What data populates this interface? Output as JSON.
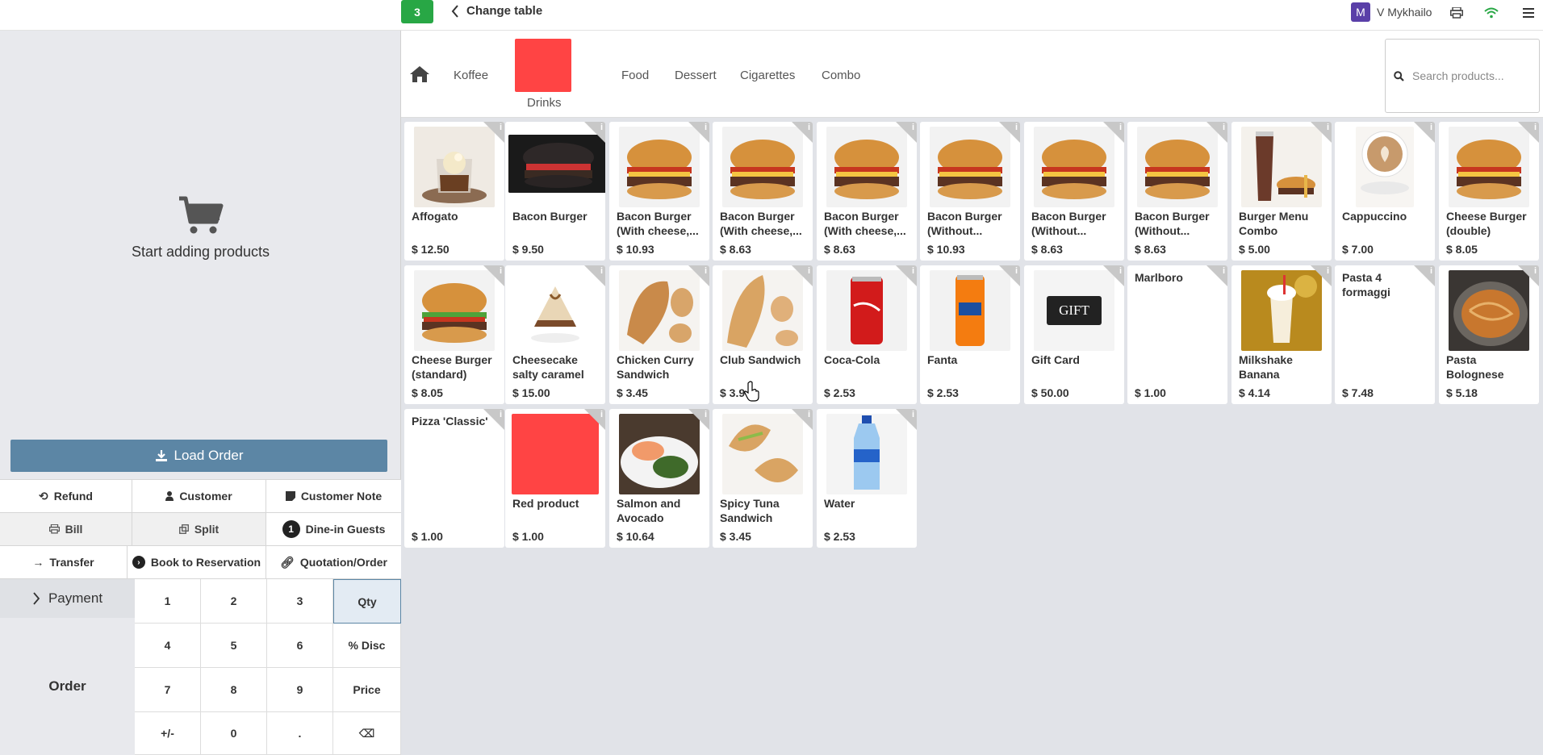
{
  "topbar": {
    "table_number": "3",
    "change_table_label": "Change table",
    "user_initial": "M",
    "user_name": "V Mykhailo"
  },
  "left": {
    "empty_cart_label": "Start adding products",
    "load_order_label": "Load Order",
    "controls": {
      "refund": "Refund",
      "customer": "Customer",
      "customer_note": "Customer Note",
      "bill": "Bill",
      "split": "Split",
      "guests_count": "1",
      "dine_in_guests": "Dine-in Guests",
      "transfer": "Transfer",
      "book_reservation": "Book to Reservation",
      "quotation_order": "Quotation/Order"
    },
    "payment_label": "Payment",
    "order_label": "Order",
    "numpad": [
      "1",
      "2",
      "3",
      "Qty",
      "4",
      "5",
      "6",
      "% Disc",
      "7",
      "8",
      "9",
      "Price",
      "+/-",
      "0",
      ".",
      "⌫"
    ]
  },
  "categories": {
    "items": [
      "Koffee",
      "Drinks",
      "Food",
      "Dessert",
      "Cigarettes",
      "Combo"
    ],
    "active_color": "#ff4444"
  },
  "search": {
    "placeholder": "Search products..."
  },
  "products": [
    {
      "name": "Affogato",
      "price": "$ 12.50"
    },
    {
      "name": "Bacon Burger",
      "price": "$ 9.50"
    },
    {
      "name": "Bacon Burger (With cheese,...",
      "price": "$ 10.93"
    },
    {
      "name": "Bacon Burger (With cheese,...",
      "price": "$ 8.63"
    },
    {
      "name": "Bacon Burger (With cheese,...",
      "price": "$ 8.63"
    },
    {
      "name": "Bacon Burger (Without...",
      "price": "$ 10.93"
    },
    {
      "name": "Bacon Burger (Without...",
      "price": "$ 8.63"
    },
    {
      "name": "Bacon Burger (Without...",
      "price": "$ 8.63"
    },
    {
      "name": "Burger Menu Combo",
      "price": "$ 5.00"
    },
    {
      "name": "Cappuccino",
      "price": "$ 7.00"
    },
    {
      "name": "Cheese Burger (double)",
      "price": "$ 8.05"
    },
    {
      "name": "Cheese Burger (standard)",
      "price": "$ 8.05"
    },
    {
      "name": "Cheesecake salty caramel",
      "price": "$ 15.00"
    },
    {
      "name": "Chicken Curry Sandwich",
      "price": "$ 3.45"
    },
    {
      "name": "Club Sandwich",
      "price": "$ 3.9"
    },
    {
      "name": "Coca-Cola",
      "price": "$ 2.53"
    },
    {
      "name": "Fanta",
      "price": "$ 2.53"
    },
    {
      "name": "Gift Card",
      "price": "$ 50.00"
    },
    {
      "name": "Marlboro",
      "price": "$ 1.00"
    },
    {
      "name": "Milkshake Banana",
      "price": "$ 4.14"
    },
    {
      "name": "Pasta 4 formaggi",
      "price": "$ 7.48"
    },
    {
      "name": "Pasta Bolognese",
      "price": "$ 5.18"
    },
    {
      "name": "Pizza 'Classic'",
      "price": "$ 1.00"
    },
    {
      "name": "Red product",
      "price": "$ 1.00"
    },
    {
      "name": "Salmon and Avocado",
      "price": "$ 10.64"
    },
    {
      "name": "Spicy Tuna Sandwich",
      "price": "$ 3.45"
    },
    {
      "name": "Water",
      "price": "$ 2.53"
    }
  ],
  "gift_card_text": "GIFT"
}
